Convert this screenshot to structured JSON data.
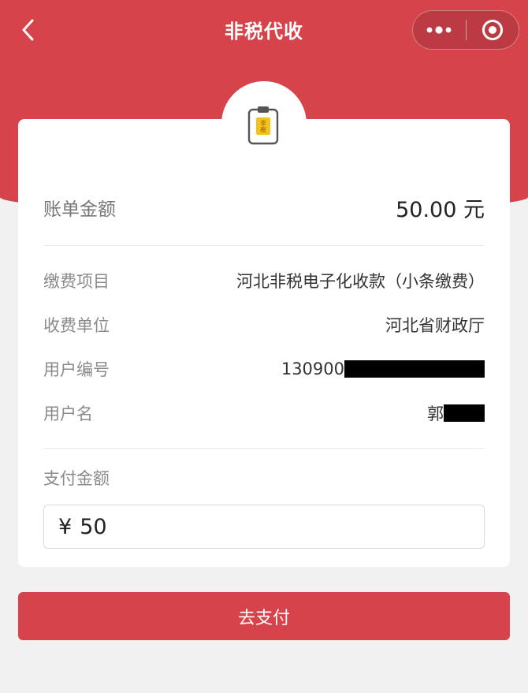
{
  "header": {
    "title": "非税代收",
    "back_icon": "chevron-left-icon",
    "more_icon": "more-dots-icon",
    "close_icon": "target-close-icon"
  },
  "colors": {
    "brand": "#d7434a",
    "background": "#f1f1f1",
    "badge_yellow": "#f5c11a"
  },
  "badge": {
    "icon": "clipboard-icon",
    "text_line1": "非",
    "text_line2": "税"
  },
  "bill": {
    "label": "账单金额",
    "amount": "50.00 元"
  },
  "details": [
    {
      "label": "缴费项目",
      "value": "河北非税电子化收款（小条缴费）"
    },
    {
      "label": "收费单位",
      "value": "河北省财政厅"
    },
    {
      "label": "用户编号",
      "value": "130900"
    },
    {
      "label": "用户名",
      "value": "郭"
    }
  ],
  "payment": {
    "label": "支付金额",
    "currency": "¥",
    "value": "50"
  },
  "submit": {
    "label": "去支付"
  }
}
